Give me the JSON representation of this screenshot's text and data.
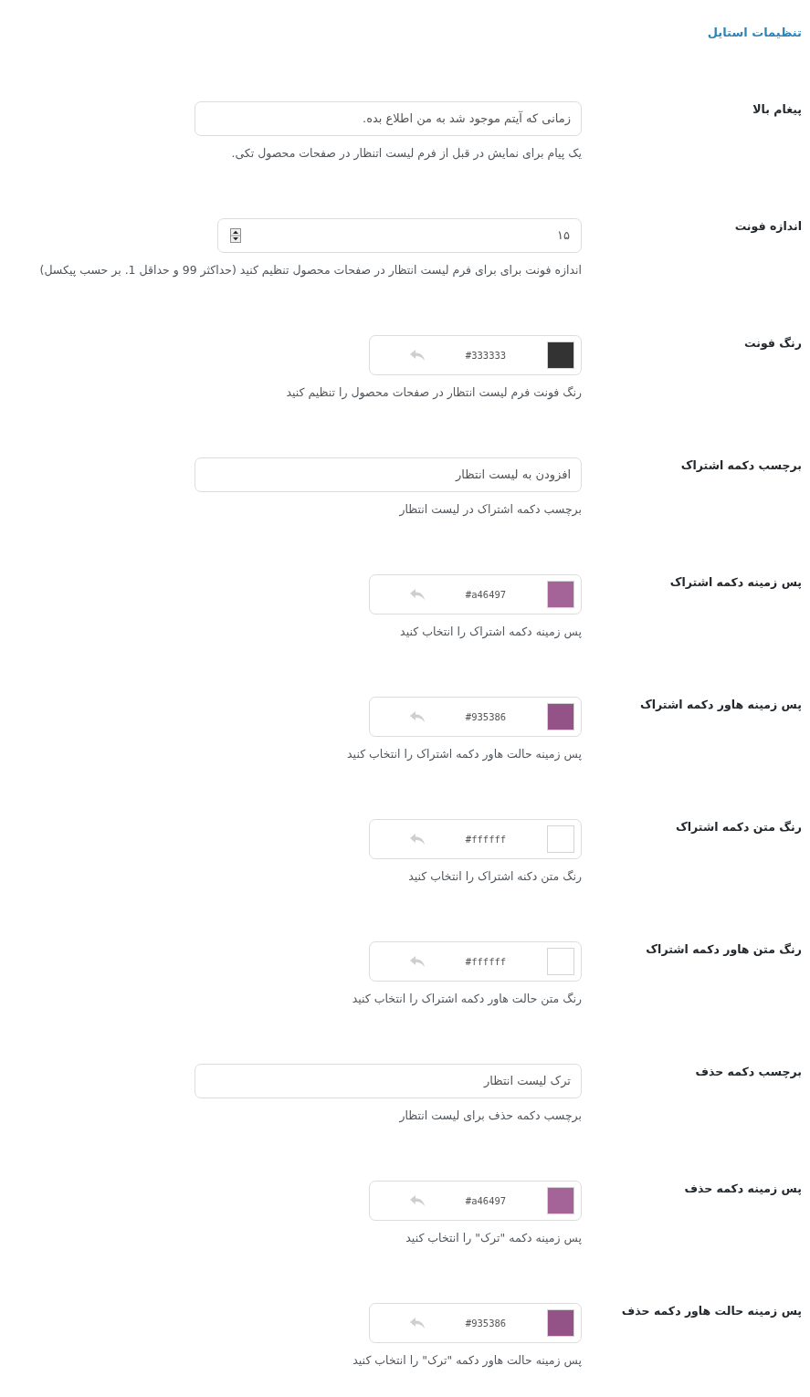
{
  "title": "تنظیمات استایل",
  "settings": [
    {
      "kind": "text",
      "label": "پیغام بالا",
      "value": "زمانی که آیتم موجود شد به من اطلاع بده.",
      "description": "یک پیام برای نمایش در قبل از فرم لیست اتنظار در صفحات محصول تکی."
    },
    {
      "kind": "number",
      "label": "اندازه فونت",
      "value": "۱۵",
      "description": "اندازه فونت برای برای فرم لیست انتظار در صفحات محصول تنظیم کنید (حداکثر 99 و حداقل 1. بر حسب پیکسل)"
    },
    {
      "kind": "color",
      "label": "رنگ فونت",
      "color": "#333333",
      "description": "رنگ فونت فرم لیست انتظار در صفحات محصول را تنظیم کنید"
    },
    {
      "kind": "text",
      "label": "برچسب دکمه اشتراک",
      "value": "افزودن به لیست انتظار",
      "description": "برچسب دکمه اشتراک در لیست انتظار"
    },
    {
      "kind": "color",
      "label": "پس زمینه دکمه اشتراک",
      "color": "#a46497",
      "description": "پس زمینه دکمه اشتراک را انتخاب کنید"
    },
    {
      "kind": "color",
      "label": "پس زمینه هاور دکمه اشتراک",
      "color": "#935386",
      "description": "پس زمینه حالت هاور دکمه اشتراک را انتخاب کنید"
    },
    {
      "kind": "color",
      "label": "رنگ متن دکمه اشتراک",
      "color": "#ffffff",
      "description": "رنگ متن دکنه اشتراک را انتخاب کنید"
    },
    {
      "kind": "color",
      "label": "رنگ متن هاور دکمه اشتراک",
      "color": "#ffffff",
      "description": "رنگ متن حالت هاور دکمه اشتراک را انتخاب کنید"
    },
    {
      "kind": "text",
      "label": "برچسب دکمه حذف",
      "value": "ترک لیست انتظار",
      "description": "برچسب دکمه حذف برای لیست انتظار"
    },
    {
      "kind": "color",
      "label": "پس زمینه دکمه حذف",
      "color": "#a46497",
      "description": "پس زمینه دکمه \"ترک\" را انتخاب کنید"
    },
    {
      "kind": "color",
      "label": "پس زمینه حالت هاور دکمه حذف",
      "color": "#935386",
      "description": "پس زمینه حالت هاور دکمه \"ترک\" را انتخاب کنید"
    }
  ]
}
